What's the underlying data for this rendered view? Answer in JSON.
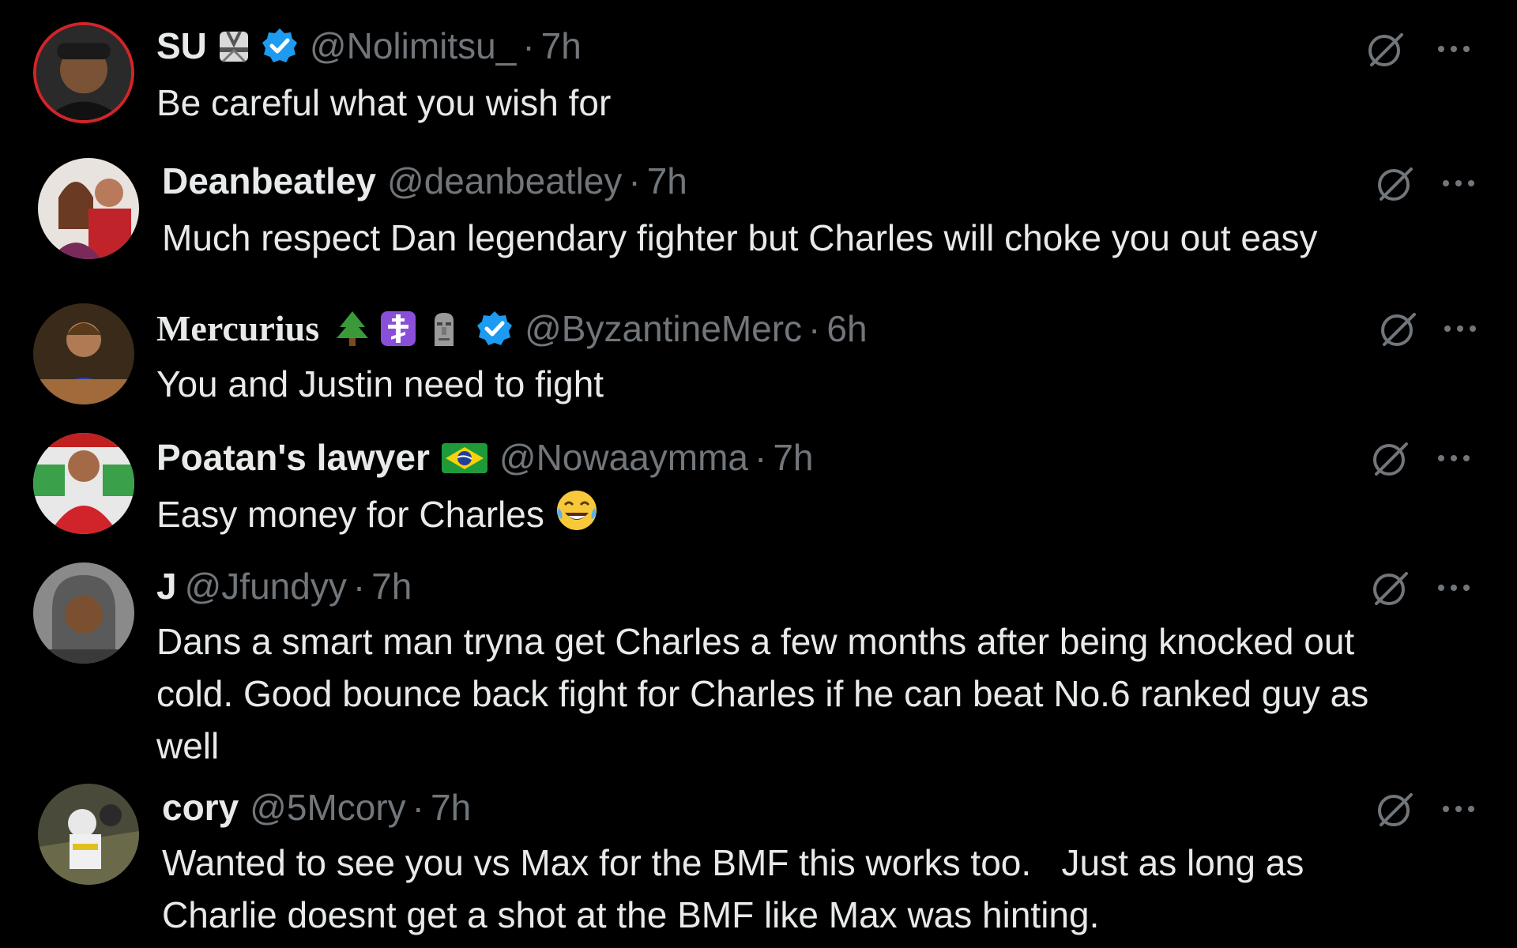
{
  "replies": [
    {
      "name": "SU",
      "handle": "@Nolimitsu_",
      "time": "7h",
      "dot": "·",
      "text": "Be careful what you wish for",
      "badges": [
        "gi-icon",
        "verified-icon"
      ]
    },
    {
      "name": "Deanbeatley",
      "handle": "@deanbeatley",
      "time": "7h",
      "dot": "·",
      "text": "Much respect Dan legendary fighter but Charles will choke you out easy",
      "badges": []
    },
    {
      "name": "Mercurius",
      "handle": "@ByzantineMerc",
      "time": "6h",
      "dot": "·",
      "text": "You and Justin need to fight",
      "badges": [
        "tree-icon",
        "orthodox-cross-icon",
        "moai-icon",
        "verified-icon"
      ]
    },
    {
      "name": "Poatan's lawyer",
      "handle": "@Nowaaymma",
      "time": "7h",
      "dot": "·",
      "text": "Easy money for Charles",
      "badges": [
        "brazil-flag-icon"
      ],
      "trailing_emoji": "laughing-tears-icon"
    },
    {
      "name": "J",
      "handle": "@Jfundyy",
      "time": "7h",
      "dot": "·",
      "text_lines": [
        "Dans a smart man tryna get Charles a few months after being knocked out",
        "cold. Good bounce back fight for Charles if he can beat No.6 ranked guy as",
        "well"
      ],
      "badges": []
    },
    {
      "name": "cory",
      "handle": "@5Mcory",
      "time": "7h",
      "dot": "·",
      "text_lines": [
        "Wanted to see you vs Max for the BMF this works too.   Just as long as",
        "Charlie doesnt get a shot at the BMF like Max was hinting."
      ],
      "badges": []
    }
  ],
  "colors": {
    "background": "#000000",
    "primary_text": "#e7e9ea",
    "secondary_text": "#71767b",
    "verified_blue": "#1d9bf0",
    "avatar_ring": "#d0252a"
  },
  "icons": {
    "grok": "grok-icon",
    "more": "more-options-icon"
  }
}
